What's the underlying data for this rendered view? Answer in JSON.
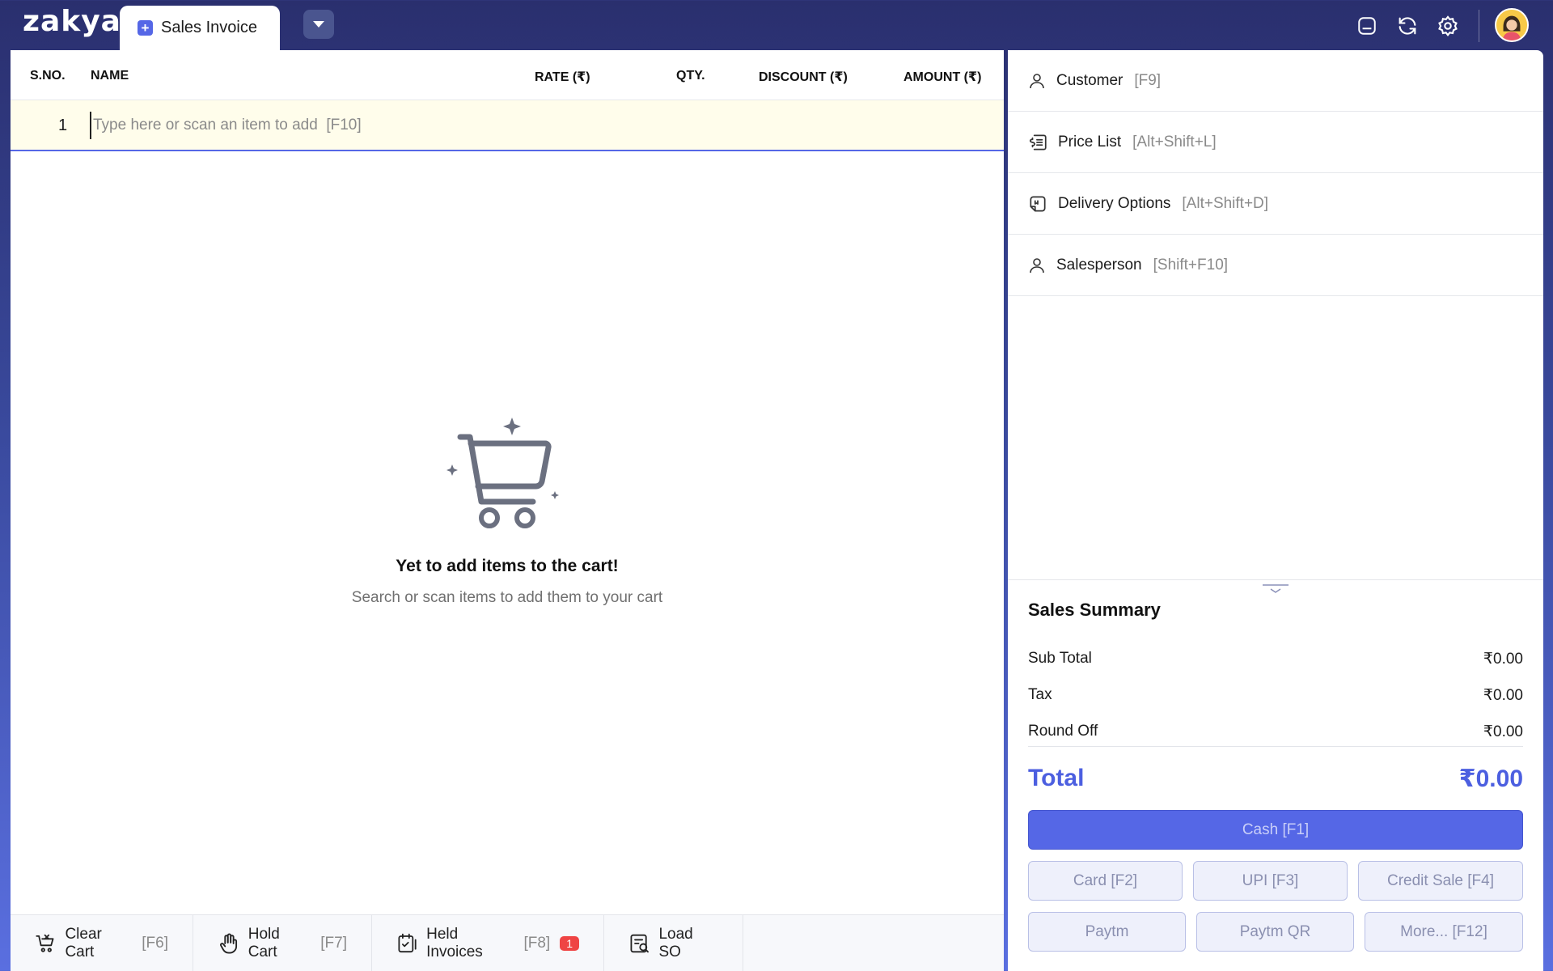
{
  "app": {
    "logo": "zakya"
  },
  "tab": {
    "label": "Sales Invoice"
  },
  "table": {
    "columns": [
      "S.NO.",
      "NAME",
      "RATE (₹)",
      "QTY.",
      "DISCOUNT (₹)",
      "AMOUNT (₹)"
    ],
    "row_number": "1",
    "input_placeholder": "Type here or scan an item to add  [F10]"
  },
  "empty_state": {
    "title": "Yet to add items to the cart!",
    "subtitle": "Search or scan items to add them to your cart"
  },
  "bottom_actions": [
    {
      "label": "Clear Cart",
      "key": "[F6]",
      "icon": "clear-cart-icon"
    },
    {
      "label": "Hold Cart",
      "key": "[F7]",
      "icon": "hand-icon"
    },
    {
      "label": "Held Invoices",
      "key": "[F8]",
      "icon": "held-invoices-icon",
      "badge": "1"
    },
    {
      "label": "Load SO",
      "key": "",
      "icon": "load-so-icon"
    }
  ],
  "right_options": [
    {
      "label": "Customer",
      "key": "[F9]",
      "icon": "user-icon"
    },
    {
      "label": "Price List",
      "key": "[Alt+Shift+L]",
      "icon": "price-list-icon"
    },
    {
      "label": "Delivery Options",
      "key": "[Alt+Shift+D]",
      "icon": "delivery-icon"
    },
    {
      "label": "Salesperson",
      "key": "[Shift+F10]",
      "icon": "user-icon"
    }
  ],
  "summary": {
    "title": "Sales Summary",
    "sub_total_label": "Sub Total",
    "sub_total": "₹0.00",
    "tax_label": "Tax",
    "tax": "₹0.00",
    "round_off_label": "Round Off",
    "round_off": "₹0.00",
    "total_label": "Total",
    "total": "₹0.00"
  },
  "payments": {
    "cash": "Cash [F1]",
    "card": "Card [F2]",
    "upi": "UPI [F3]",
    "credit": "Credit Sale [F4]",
    "paytm": "Paytm",
    "paytm_qr": "Paytm QR",
    "more": "More... [F12]"
  },
  "colors": {
    "accent": "#5567e6",
    "badge": "#ef4444",
    "input_row_bg": "#fffdeb"
  }
}
